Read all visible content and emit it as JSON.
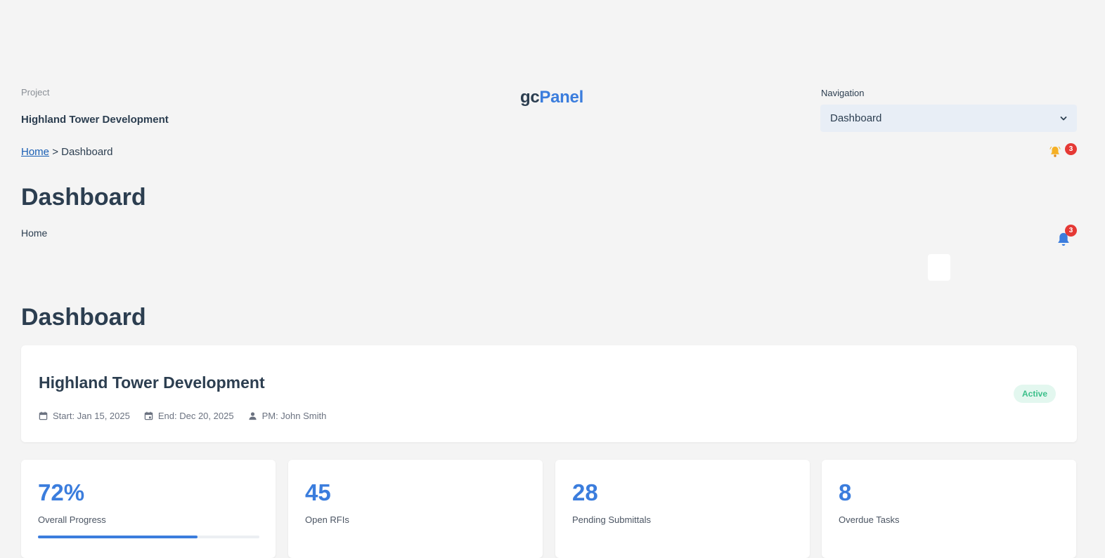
{
  "header": {
    "project_label": "Project",
    "project_name": "Highland Tower Development",
    "breadcrumb": {
      "home": "Home",
      "separator": ">",
      "current": "Dashboard"
    },
    "brand": {
      "part1": "gc",
      "part2": "Panel"
    },
    "navigation": {
      "label": "Navigation",
      "selected": "Dashboard"
    },
    "notification_count": "3"
  },
  "page": {
    "title": "Dashboard",
    "subtitle": "Home",
    "notification_count": "3",
    "section_title": "Dashboard"
  },
  "project_card": {
    "title": "Highland Tower Development",
    "start": "Start: Jan 15, 2025",
    "end": "End: Dec 20, 2025",
    "pm": "PM: John Smith",
    "status": "Active"
  },
  "stats": [
    {
      "value": "72%",
      "label": "Overall Progress",
      "progress": 0.72
    },
    {
      "value": "45",
      "label": "Open RFIs"
    },
    {
      "value": "28",
      "label": "Pending Submittals"
    },
    {
      "value": "8",
      "label": "Overdue Tasks"
    }
  ],
  "colors": {
    "accent": "#3b7ddd",
    "badge": "#e53935",
    "status_bg": "#e3f7ef",
    "status_text": "#3bbf8a"
  },
  "icons": {
    "bell_small": "bell-icon",
    "bell_large": "bell-icon",
    "calendar": "calendar-icon",
    "person": "person-icon",
    "chevron": "chevron-down-icon"
  }
}
